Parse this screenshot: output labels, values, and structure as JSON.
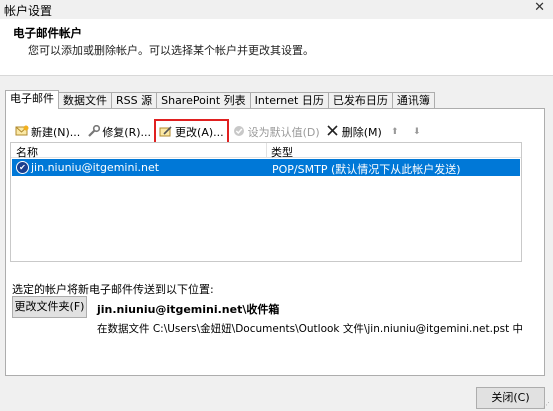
{
  "window": {
    "title": "帐户设置",
    "close_glyph": "✕"
  },
  "header": {
    "title": "电子邮件帐户",
    "subtitle": "您可以添加或删除帐户。可以选择某个帐户并更改其设置。"
  },
  "tabs": [
    {
      "label": "电子邮件",
      "active": true
    },
    {
      "label": "数据文件"
    },
    {
      "label": "RSS 源"
    },
    {
      "label": "SharePoint 列表"
    },
    {
      "label": "Internet 日历"
    },
    {
      "label": "已发布日历"
    },
    {
      "label": "通讯簿"
    }
  ],
  "toolbar": {
    "new_label": "新建(N)...",
    "repair_label": "修复(R)...",
    "change_label": "更改(A)...",
    "set_default_label": "设为默认值(D)",
    "remove_label": "删除(M)",
    "up_glyph": "⬆",
    "down_glyph": "⬇"
  },
  "accounts_table": {
    "columns": [
      "名称",
      "类型"
    ],
    "rows": [
      {
        "name": "jin.niuniu@itgemini.net",
        "type": "POP/SMTP (默认情况下从此帐户发送)",
        "selected": true,
        "default": true
      }
    ]
  },
  "delivery": {
    "label": "选定的帐户将新电子邮件传送到以下位置:",
    "change_folder_label": "更改文件夹(F)",
    "destination": "jin.niuniu@itgemini.net\\收件箱",
    "data_file_path": "在数据文件 C:\\Users\\金妞妞\\Documents\\Outlook 文件\\jin.niuniu@itgemini.net.pst 中"
  },
  "footer": {
    "close_label": "关闭(C)"
  },
  "colors": {
    "selection": "#0078d7",
    "highlight_box": "#e02020"
  }
}
